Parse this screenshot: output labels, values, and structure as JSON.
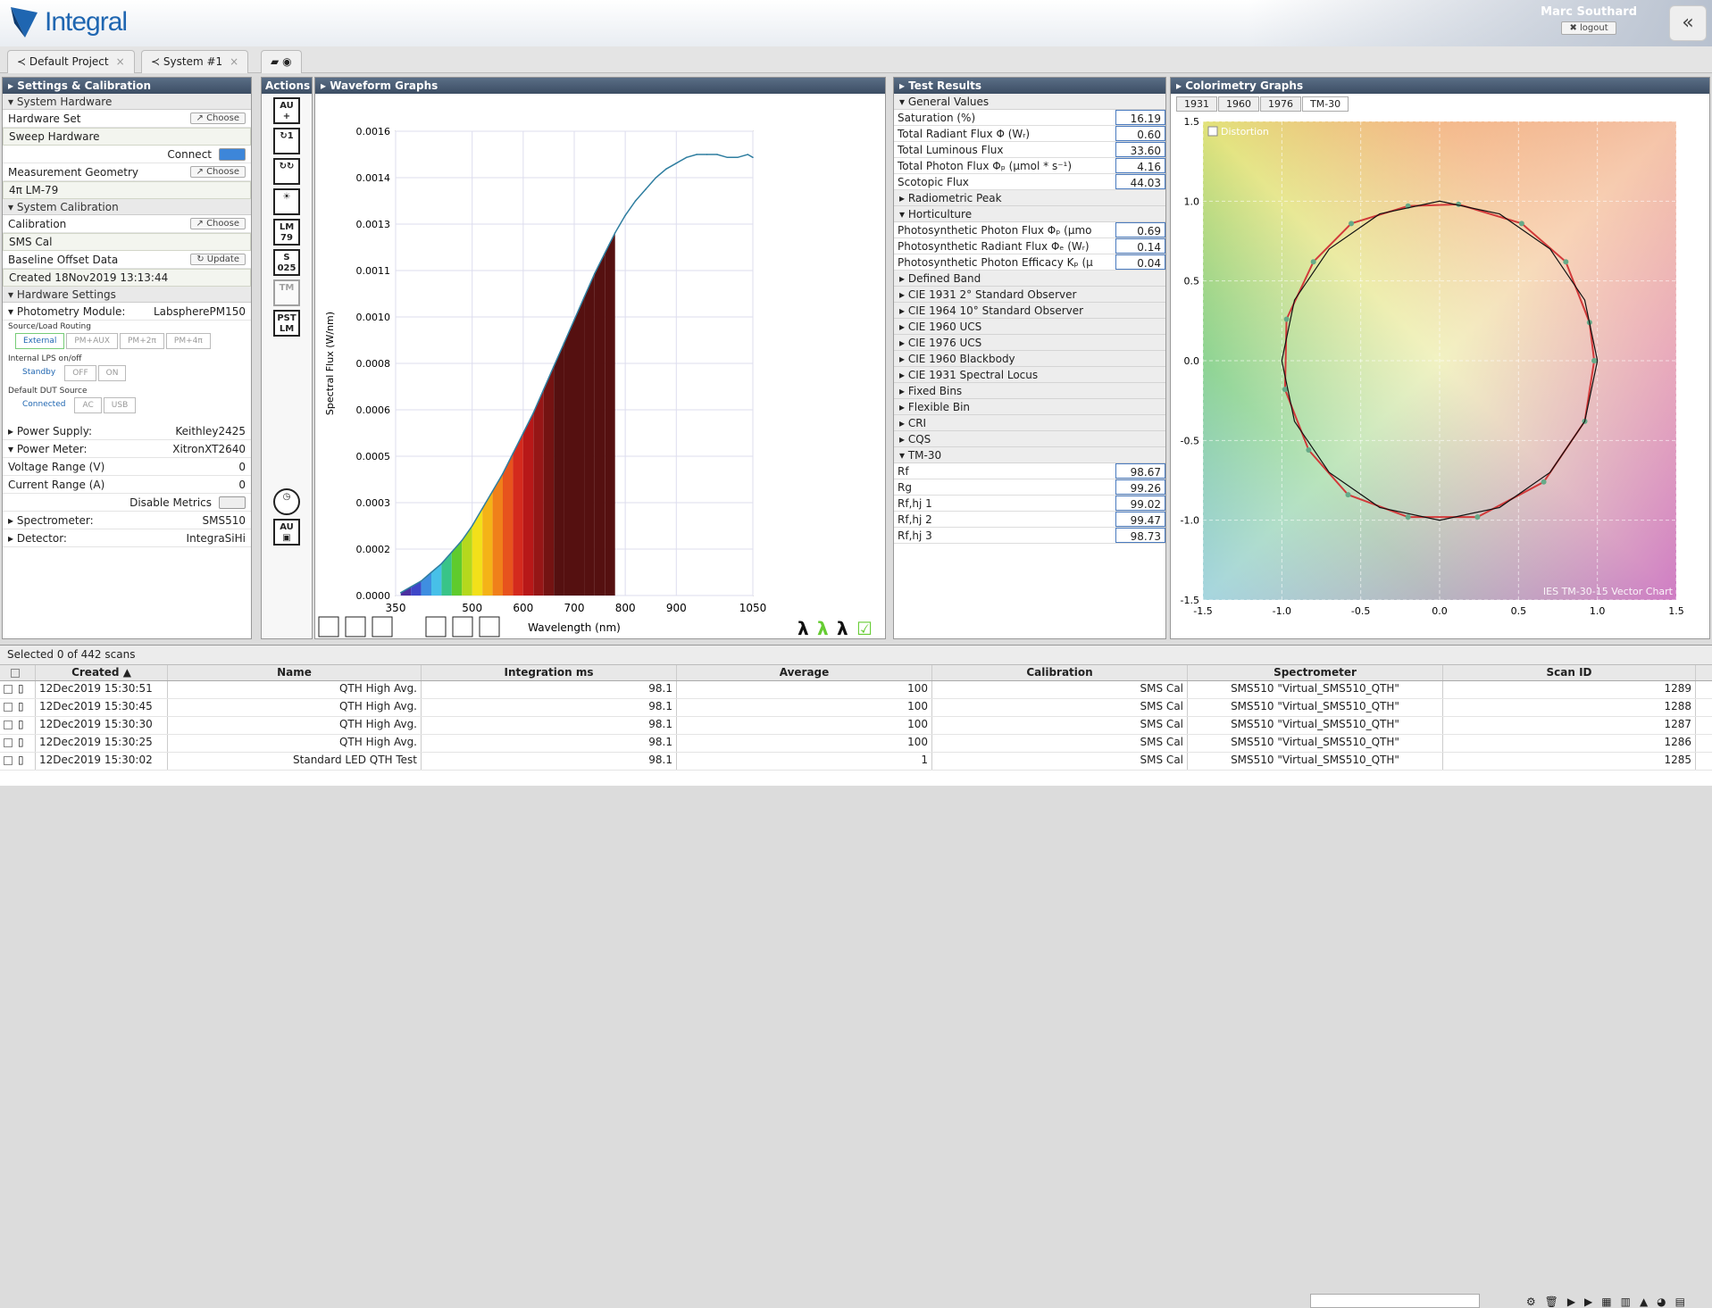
{
  "app": {
    "title": "Integral",
    "user": "Marc Southard",
    "logout": "logout",
    "collapse": "«"
  },
  "tabs": [
    {
      "label": "Default Project"
    },
    {
      "label": "System #1"
    }
  ],
  "settings": {
    "header": "Settings & Calibration",
    "system_hardware": "System Hardware",
    "hardware_set": "Hardware Set",
    "choose": "Choose",
    "sweep": "Sweep Hardware",
    "connect": "Connect",
    "meas_geom": "Measurement Geometry",
    "geom_value": "4π LM-79",
    "system_cal": "System Calibration",
    "calibration": "Calibration",
    "cal_value": "SMS Cal",
    "baseline": "Baseline Offset Data",
    "update": "Update",
    "baseline_value": "Created 18Nov2019 13:13:44",
    "hw_settings": "Hardware Settings",
    "photometry": "Photometry Module:",
    "photometry_value": "LabspherePM150",
    "routing": "Source/Load Routing",
    "routing_opts": [
      "External",
      "PM+AUX",
      "PM+2π",
      "PM+4π"
    ],
    "lps": "Internal LPS on/off",
    "standby": "Standby",
    "off": "OFF",
    "on": "ON",
    "dut": "Default DUT Source",
    "connected": "Connected",
    "ac": "AC",
    "usb": "USB",
    "power_supply": "Power Supply:",
    "power_supply_value": "Keithley2425",
    "power_meter": "Power Meter:",
    "power_meter_value": "XitronXT2640",
    "voltage": "Voltage Range (V)",
    "voltage_value": "0",
    "current": "Current Range (A)",
    "current_value": "0",
    "disable": "Disable Metrics",
    "spectrometer": "Spectrometer:",
    "spectrometer_value": "SMS510",
    "detector": "Detector:",
    "detector_value": "IntegraSiHi"
  },
  "actions": {
    "header": "Actions"
  },
  "waveform": {
    "header": "Waveform Graphs"
  },
  "chart_data": [
    {
      "type": "area",
      "xlabel": "Wavelength (nm)",
      "ylabel": "Spectral Flux (W/nm)",
      "xlim": [
        350,
        1050
      ],
      "ylim": [
        0,
        0.0016
      ],
      "xticks": [
        "350",
        "500",
        "600",
        "700",
        "800",
        "900",
        "1050"
      ],
      "yticks": [
        "0.0000",
        "0.0002",
        "0.0003",
        "0.0005",
        "0.0006",
        "0.0008",
        "0.0010",
        "0.0011",
        "0.0013",
        "0.0014",
        "0.0016"
      ],
      "x": [
        360,
        380,
        400,
        420,
        440,
        460,
        480,
        500,
        520,
        540,
        560,
        580,
        600,
        620,
        640,
        660,
        680,
        700,
        720,
        740,
        760,
        780,
        800,
        820,
        840,
        860,
        880,
        900,
        920,
        940,
        960,
        980,
        1000,
        1020,
        1040,
        1050
      ],
      "y": [
        1e-05,
        3e-05,
        5e-05,
        8e-05,
        0.00011,
        0.00015,
        0.00019,
        0.00024,
        0.0003,
        0.00036,
        0.00042,
        0.00049,
        0.00056,
        0.00063,
        0.00071,
        0.00079,
        0.00087,
        0.00095,
        0.00103,
        0.00111,
        0.00118,
        0.00125,
        0.00131,
        0.00136,
        0.0014,
        0.00144,
        0.00147,
        0.00149,
        0.00151,
        0.00152,
        0.00152,
        0.00152,
        0.00151,
        0.00151,
        0.00152,
        0.00151
      ]
    },
    {
      "type": "line",
      "title": "",
      "xlim": [
        -1.5,
        1.5
      ],
      "ylim": [
        -1.5,
        1.5
      ],
      "xticks": [
        "-1.5",
        "-1.0",
        "-0.5",
        "0.0",
        "0.5",
        "1.0",
        "1.5"
      ],
      "yticks": [
        "1.5",
        "1.0",
        "0.5",
        "0.0",
        "-0.5",
        "-1.0",
        "-1.5"
      ],
      "legend": "IES TM-30-15 Vector Chart",
      "distortion": "Distortion",
      "series": [
        {
          "values": [
            [
              0.98,
              0.0
            ],
            [
              0.92,
              -0.38
            ],
            [
              0.66,
              -0.76
            ],
            [
              0.24,
              -0.98
            ],
            [
              -0.2,
              -0.98
            ],
            [
              -0.58,
              -0.84
            ],
            [
              -0.83,
              -0.56
            ],
            [
              -0.98,
              -0.18
            ],
            [
              -0.97,
              0.26
            ],
            [
              -0.8,
              0.62
            ],
            [
              -0.56,
              0.86
            ],
            [
              -0.2,
              0.97
            ],
            [
              0.12,
              0.98
            ],
            [
              0.52,
              0.86
            ],
            [
              0.8,
              0.62
            ],
            [
              0.95,
              0.24
            ],
            [
              0.98,
              0.0
            ]
          ]
        },
        {
          "values": [
            [
              1.0,
              0.0
            ],
            [
              0.92,
              -0.38
            ],
            [
              0.7,
              -0.7
            ],
            [
              0.38,
              -0.92
            ],
            [
              0.0,
              -1.0
            ],
            [
              -0.38,
              -0.92
            ],
            [
              -0.7,
              -0.7
            ],
            [
              -0.92,
              -0.38
            ],
            [
              -1.0,
              0.0
            ],
            [
              -0.92,
              0.38
            ],
            [
              -0.7,
              0.7
            ],
            [
              -0.38,
              0.92
            ],
            [
              0.0,
              1.0
            ],
            [
              0.38,
              0.92
            ],
            [
              0.7,
              0.7
            ],
            [
              0.92,
              0.38
            ],
            [
              1.0,
              0.0
            ]
          ]
        }
      ]
    }
  ],
  "test": {
    "header": "Test Results",
    "general": "General Values",
    "general_rows": [
      {
        "label": "Saturation (%)",
        "value": "16.19"
      },
      {
        "label": "Total Radiant Flux Φ (Wᵣ)",
        "value": "0.60"
      },
      {
        "label": "Total Luminous Flux",
        "value": "33.60"
      },
      {
        "label": "Total Photon Flux Φₚ (μmol * s⁻¹)",
        "value": "4.16"
      },
      {
        "label": "Scotopic Flux",
        "value": "44.03"
      }
    ],
    "radiometric": "Radiometric Peak",
    "horticulture": "Horticulture",
    "hort_rows": [
      {
        "label": "Photosynthetic Photon Flux Φₚ (μmo",
        "value": "0.69"
      },
      {
        "label": "Photosynthetic Radiant Flux Φₑ (Wᵣ)",
        "value": "0.14"
      },
      {
        "label": "Photosynthetic Photon Efficacy Kₚ (μ",
        "value": "0.04"
      }
    ],
    "sections": [
      "Defined Band",
      "CIE 1931 2° Standard Observer",
      "CIE 1964 10° Standard Observer",
      "CIE 1960 UCS",
      "CIE 1976 UCS",
      "CIE 1960 Blackbody",
      "CIE 1931 Spectral Locus",
      "Fixed Bins",
      "Flexible Bin",
      "CRI",
      "CQS"
    ],
    "tm30": "TM-30",
    "tm_rows": [
      {
        "label": "Rf",
        "value": "98.67"
      },
      {
        "label": "Rg",
        "value": "99.26"
      },
      {
        "label": "Rf,hj 1",
        "value": "99.02"
      },
      {
        "label": "Rf,hj 2",
        "value": "99.47"
      },
      {
        "label": "Rf,hj 3",
        "value": "98.73"
      }
    ]
  },
  "color": {
    "header": "Colorimetry Graphs",
    "tabs": [
      "1931",
      "1960",
      "1976",
      "TM-30"
    ]
  },
  "grid": {
    "selected": "Selected 0 of 442 scans",
    "columns": [
      "Created",
      "Name",
      "Integration ms",
      "Average",
      "Calibration",
      "Spectrometer",
      "Scan ID"
    ],
    "rows": [
      {
        "created": "12Dec2019 15:30:51",
        "name": "QTH High Avg.",
        "int": "98.1",
        "avg": "100",
        "cal": "SMS Cal",
        "spec": "SMS510 \"Virtual_SMS510_QTH\"",
        "id": "1289"
      },
      {
        "created": "12Dec2019 15:30:45",
        "name": "QTH High Avg.",
        "int": "98.1",
        "avg": "100",
        "cal": "SMS Cal",
        "spec": "SMS510 \"Virtual_SMS510_QTH\"",
        "id": "1288"
      },
      {
        "created": "12Dec2019 15:30:30",
        "name": "QTH High Avg.",
        "int": "98.1",
        "avg": "100",
        "cal": "SMS Cal",
        "spec": "SMS510 \"Virtual_SMS510_QTH\"",
        "id": "1287"
      },
      {
        "created": "12Dec2019 15:30:25",
        "name": "QTH High Avg.",
        "int": "98.1",
        "avg": "100",
        "cal": "SMS Cal",
        "spec": "SMS510 \"Virtual_SMS510_QTH\"",
        "id": "1286"
      },
      {
        "created": "12Dec2019 15:30:02",
        "name": "Standard LED QTH Test",
        "int": "98.1",
        "avg": "1",
        "cal": "SMS Cal",
        "spec": "SMS510 \"Virtual_SMS510_QTH\"",
        "id": "1285"
      }
    ]
  }
}
